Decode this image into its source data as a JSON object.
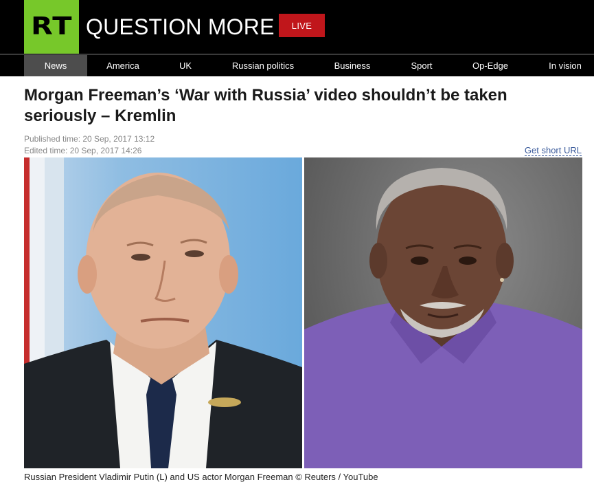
{
  "header": {
    "logo": "RT",
    "tagline": "QUESTION MORE",
    "live_label": "LIVE"
  },
  "nav": {
    "items": [
      {
        "label": "News",
        "active": true
      },
      {
        "label": "America"
      },
      {
        "label": "UK"
      },
      {
        "label": "Russian politics"
      },
      {
        "label": "Business"
      },
      {
        "label": "Sport"
      },
      {
        "label": "Op-Edge"
      },
      {
        "label": "In vision"
      }
    ]
  },
  "article": {
    "title": "Morgan Freeman’s ‘War with Russia’ video shouldn’t be taken seriously – Kremlin",
    "published": "Published time: 20 Sep, 2017 13:12",
    "edited": "Edited time: 20 Sep, 2017 14:26",
    "short_url_label": "Get short URL",
    "caption": "Russian President Vladimir Putin (L) and US actor Morgan Freeman © Reuters / YouTube"
  },
  "colors": {
    "brand_green": "#77c82a",
    "live_red": "#c0161b",
    "nav_active": "#4d4d4d",
    "link_blue": "#3b5b9b"
  }
}
